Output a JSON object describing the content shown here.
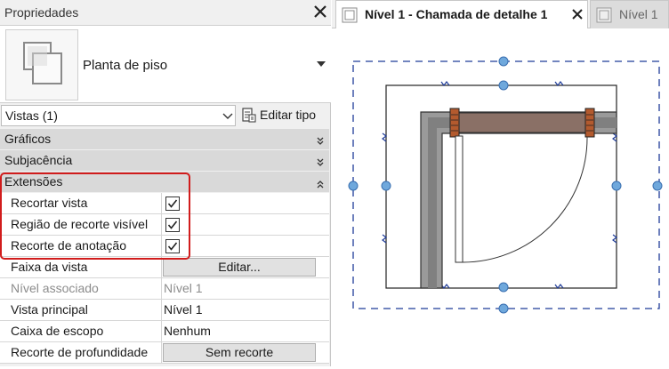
{
  "properties_panel": {
    "title": "Propriedades",
    "type_name": "Planta de piso",
    "view_selector": "Vistas (1)",
    "edit_type_label": "Editar tipo",
    "categories": {
      "graphics": "Gráficos",
      "underlay": "Subjacência",
      "extents": "Extensões"
    },
    "rows": {
      "crop_view": {
        "label": "Recortar vista",
        "checked": true
      },
      "crop_region_visible": {
        "label": "Região de recorte visível",
        "checked": true
      },
      "annotation_crop": {
        "label": "Recorte de anotação",
        "checked": true
      },
      "view_range": {
        "label": "Faixa da vista",
        "button": "Editar..."
      },
      "associated_level": {
        "label": "Nível associado",
        "value": "Nível 1"
      },
      "parent_view": {
        "label": "Vista principal",
        "value": "Nível 1"
      },
      "scope_box": {
        "label": "Caixa de escopo",
        "value": "Nenhum"
      },
      "depth_clipping": {
        "label": "Recorte de profundidade",
        "button": "Sem recorte"
      }
    }
  },
  "tabs": {
    "active": "Nível 1 - Chamada de detalhe 1",
    "inactive": "Nível 1"
  },
  "colors": {
    "highlight": "#d11c1c",
    "crop_handle": "#6fa8dc",
    "crop_line": "#1f3c99",
    "wall_fill": "#8a7066",
    "wall_gray": "#8c8c8c"
  }
}
